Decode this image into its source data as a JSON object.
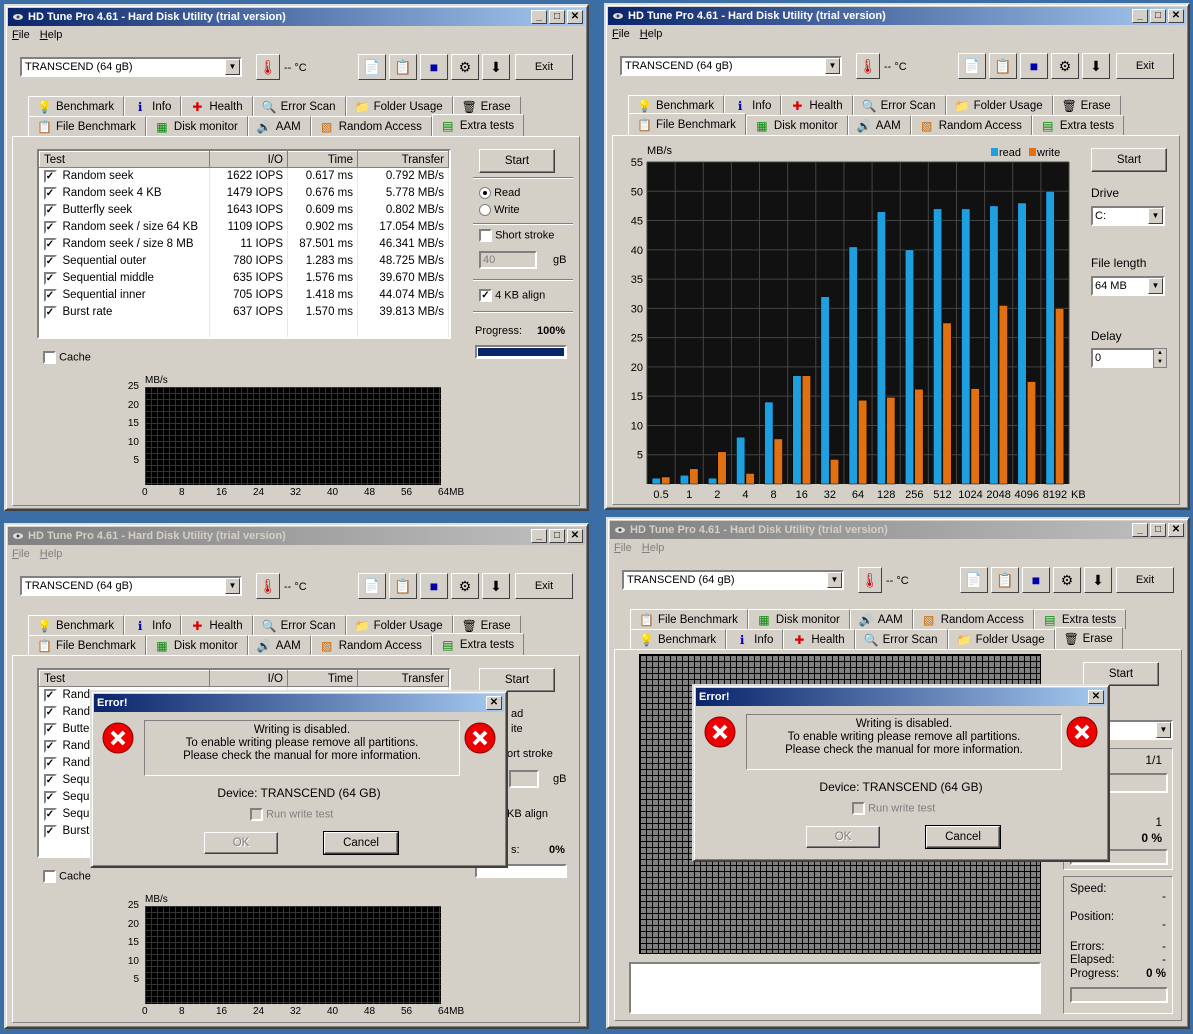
{
  "app": {
    "title": "HD Tune Pro 4.61 - Hard Disk Utility (trial version)",
    "menu": [
      "File",
      "Help"
    ],
    "drive": "TRANSCEND (64 gB)",
    "temp": "-- °C",
    "exit": "Exit"
  },
  "tabs_benchmark_row": [
    "Benchmark",
    "Info",
    "Health",
    "Error Scan",
    "Folder Usage",
    "Erase"
  ],
  "tabs_file_row": [
    "File Benchmark",
    "Disk monitor",
    "AAM",
    "Random Access",
    "Extra tests"
  ],
  "extra_tests": {
    "headers": [
      "Test",
      "I/O",
      "Time",
      "Transfer"
    ],
    "rows": [
      {
        "name": "Random seek",
        "io": "1622 IOPS",
        "time": "0.617 ms",
        "transfer": "0.792 MB/s"
      },
      {
        "name": "Random seek 4 KB",
        "io": "1479 IOPS",
        "time": "0.676 ms",
        "transfer": "5.778 MB/s"
      },
      {
        "name": "Butterfly seek",
        "io": "1643 IOPS",
        "time": "0.609 ms",
        "transfer": "0.802 MB/s"
      },
      {
        "name": "Random seek / size 64 KB",
        "io": "1109 IOPS",
        "time": "0.902 ms",
        "transfer": "17.054 MB/s"
      },
      {
        "name": "Random seek / size 8 MB",
        "io": "11 IOPS",
        "time": "87.501 ms",
        "transfer": "46.341 MB/s"
      },
      {
        "name": "Sequential outer",
        "io": "780 IOPS",
        "time": "1.283 ms",
        "transfer": "48.725 MB/s"
      },
      {
        "name": "Sequential middle",
        "io": "635 IOPS",
        "time": "1.576 ms",
        "transfer": "39.670 MB/s"
      },
      {
        "name": "Sequential inner",
        "io": "705 IOPS",
        "time": "1.418 ms",
        "transfer": "44.074 MB/s"
      },
      {
        "name": "Burst rate",
        "io": "637 IOPS",
        "time": "1.570 ms",
        "transfer": "39.813 MB/s"
      }
    ],
    "short_names": [
      "Rand",
      "Rand",
      "Butte",
      "Rand",
      "Rand",
      "Sequ",
      "Sequ",
      "Sequ",
      "Burst"
    ],
    "start": "Start",
    "read": "Read",
    "write": "Write",
    "short_stroke": "Short stroke",
    "stroke_value": "40",
    "gb": "gB",
    "align": "4 KB align",
    "progress_label": "Progress:",
    "progress_value": "100%",
    "progress_fraction": 1.0,
    "cache": "Cache",
    "mini_chart_unit": "MB/s",
    "mini_y_ticks": [
      "25",
      "20",
      "15",
      "10",
      "5"
    ],
    "mini_x_ticks": [
      "0",
      "8",
      "16",
      "24",
      "32",
      "40",
      "48",
      "56",
      "64MB"
    ],
    "bl_partial": {
      "read": "ad",
      "write": "ite",
      "stroke": "ort stroke",
      "align": "KB align",
      "progress_label": "s:",
      "progress_value": "0%"
    }
  },
  "file_benchmark": {
    "start": "Start",
    "drive_label": "Drive",
    "drive_value": "C:",
    "file_length_label": "File length",
    "file_length_value": "64 MB",
    "delay_label": "Delay",
    "delay_value": "0"
  },
  "chart_data": {
    "type": "bar",
    "categories": [
      "0.5",
      "1",
      "2",
      "4",
      "8",
      "16",
      "32",
      "64",
      "128",
      "256",
      "512",
      "1024",
      "2048",
      "4096",
      "8192"
    ],
    "x_unit": "KB",
    "ylabel": "MB/s",
    "ylim": [
      0,
      55
    ],
    "y_ticks": [
      5,
      10,
      15,
      20,
      25,
      30,
      35,
      40,
      45,
      50,
      55
    ],
    "grid": true,
    "legend_position": "top-right",
    "series": [
      {
        "name": "read",
        "color": "#1ea0e0",
        "values": [
          1,
          1.5,
          1,
          8,
          14,
          18.5,
          32,
          40.5,
          46.5,
          40,
          47,
          47,
          47.5,
          48,
          50
        ]
      },
      {
        "name": "write",
        "color": "#e07010",
        "values": [
          1.2,
          2.6,
          5.5,
          1.8,
          7.7,
          18.5,
          4.2,
          14.3,
          14.8,
          16.2,
          27.5,
          16.3,
          30.5,
          17.5,
          30
        ]
      }
    ]
  },
  "error_dialog": {
    "title": "Error!",
    "line1": "Writing is disabled.",
    "line2": "To enable writing please remove all partitions.",
    "line3": "Please check the manual for more information.",
    "device": "Device: TRANSCEND (64 GB)",
    "run_write_test": "Run write test",
    "ok": "OK",
    "cancel": "Cancel"
  },
  "erase": {
    "start": "Start",
    "pass": "1/1",
    "count": "1",
    "pct": "0 %",
    "speed_label": "Speed:",
    "position_label": "Position:",
    "errors_label": "Errors:",
    "elapsed_label": "Elapsed:",
    "progress_label": "Progress:",
    "dash": "-",
    "progress_value": "0 %"
  }
}
